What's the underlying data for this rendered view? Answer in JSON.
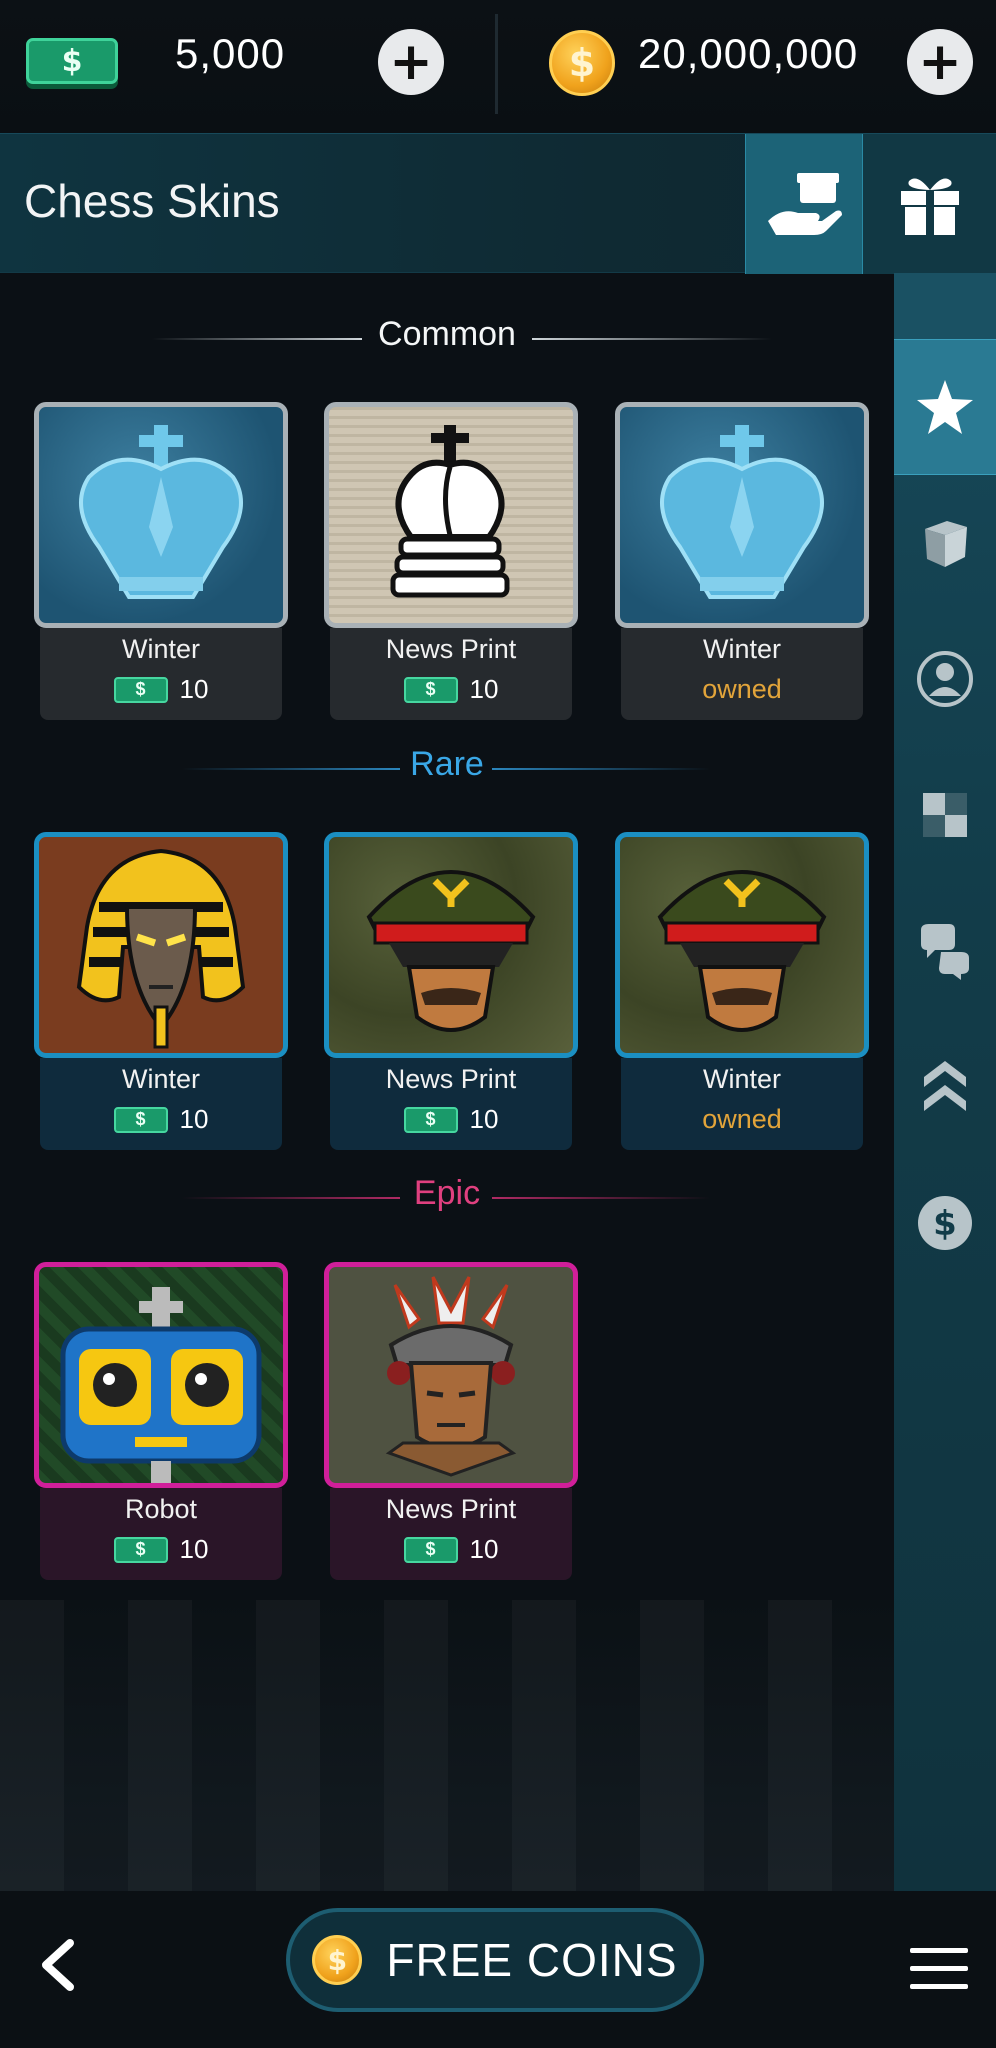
{
  "balance": {
    "cash_symbol": "$",
    "cash": "5,000",
    "coin_symbol": "$",
    "coins": "20,000,000"
  },
  "header": {
    "title": "Chess Skins"
  },
  "sections": {
    "common": {
      "title": "Common",
      "color": "#ffffff",
      "items": [
        {
          "name": "Winter",
          "price": "10",
          "art": "ice-king-icon"
        },
        {
          "name": "News Print",
          "price": "10",
          "art": "newsprint-king-icon"
        },
        {
          "name": "Winter",
          "status": "owned",
          "art": "ice-king-icon"
        }
      ]
    },
    "rare": {
      "title": "Rare",
      "color": "#3aa7e6",
      "items": [
        {
          "name": "Winter",
          "price": "10",
          "art": "pharaoh-icon"
        },
        {
          "name": "News Print",
          "price": "10",
          "art": "general-icon"
        },
        {
          "name": "Winter",
          "status": "owned",
          "art": "general-icon"
        }
      ]
    },
    "epic": {
      "title": "Epic",
      "color": "#e0407f",
      "items": [
        {
          "name": "Robot",
          "price": "10",
          "art": "robot-icon"
        },
        {
          "name": "News Print",
          "price": "10",
          "art": "chief-icon"
        }
      ]
    }
  },
  "cash_symbol_small": "$",
  "rail": [
    "star-icon",
    "box-icon",
    "avatar-icon",
    "checker-icon",
    "chat-icon",
    "rank-icon",
    "dollar-icon"
  ],
  "bottom": {
    "coin_symbol": "$",
    "free_coins": "FREE COINS"
  },
  "colors": {
    "accent": "#1c6377",
    "cash_green": "#1a9a6a",
    "owned": "#e2a43a"
  }
}
